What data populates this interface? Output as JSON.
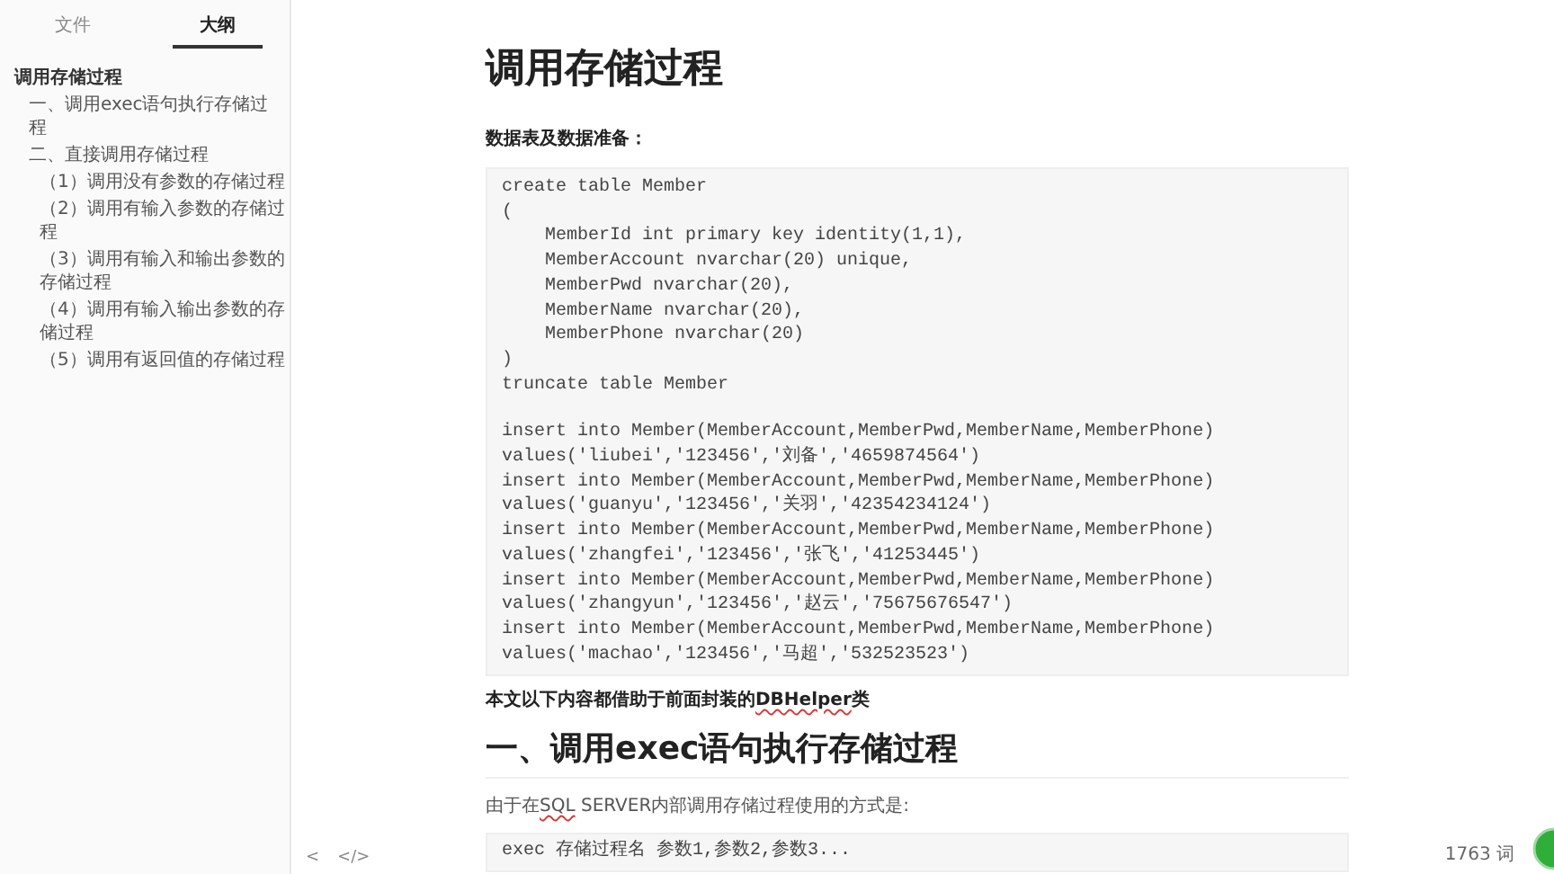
{
  "sidebar": {
    "tabs": [
      {
        "label": "文件",
        "selected": false
      },
      {
        "label": "大纲",
        "selected": true
      }
    ],
    "outline": [
      {
        "label": "调用存储过程",
        "children": [
          {
            "label": "一、调用exec语句执行存储过程"
          },
          {
            "label": "二、直接调用存储过程",
            "children": [
              {
                "label": "（1）调用没有参数的存储过程"
              },
              {
                "label": "（2）调用有输入参数的存储过程"
              },
              {
                "label": "（3）调用有输入和输出参数的存储过程"
              },
              {
                "label": "（4）调用有输入输出参数的存储过程"
              },
              {
                "label": "（5）调用有返回值的存储过程"
              }
            ]
          }
        ]
      }
    ]
  },
  "document": {
    "title": "调用存储过程",
    "subheading": "数据表及数据准备：",
    "code_block": {
      "groups": [
        [
          "create table Member",
          "(",
          "    MemberId int primary key identity(1,1),",
          "    MemberAccount nvarchar(20) unique,",
          "    MemberPwd nvarchar(20),",
          "    MemberName nvarchar(20),",
          "    MemberPhone nvarchar(20)",
          ")",
          "truncate table Member"
        ],
        [
          "insert into Member(MemberAccount,MemberPwd,MemberName,MemberPhone)",
          "values('liubei','123456','刘备','4659874564')",
          "insert into Member(MemberAccount,MemberPwd,MemberName,MemberPhone)",
          "values('guanyu','123456','关羽','42354234124')",
          "insert into Member(MemberAccount,MemberPwd,MemberName,MemberPhone)",
          "values('zhangfei','123456','张飞','41253445')",
          "insert into Member(MemberAccount,MemberPwd,MemberName,MemberPhone)",
          "values('zhangyun','123456','赵云','75675676547')",
          "insert into Member(MemberAccount,MemberPwd,MemberName,MemberPhone)",
          "values('machao','123456','马超','532523523')"
        ]
      ]
    },
    "note": [
      {
        "text": "本文以下内容都借助于前面封装的",
        "misspelled": false
      },
      {
        "text": "DBHelper",
        "misspelled": true
      },
      {
        "text": "类",
        "misspelled": false
      }
    ],
    "heading": "一、调用exec语句执行存储过程",
    "paragraph": [
      {
        "text": "由于在",
        "misspelled": false
      },
      {
        "text": "SQL",
        "misspelled": true
      },
      {
        "text": " SERVER内部调用存储过程使用的方式是:",
        "misspelled": false
      }
    ],
    "code_block_2": {
      "groups": [
        [
          "exec 存储过程名 参数1,参数2,参数3..."
        ]
      ]
    }
  },
  "footer": {
    "back_button": "<",
    "source_button": "</>",
    "word_count": "1763 词"
  }
}
